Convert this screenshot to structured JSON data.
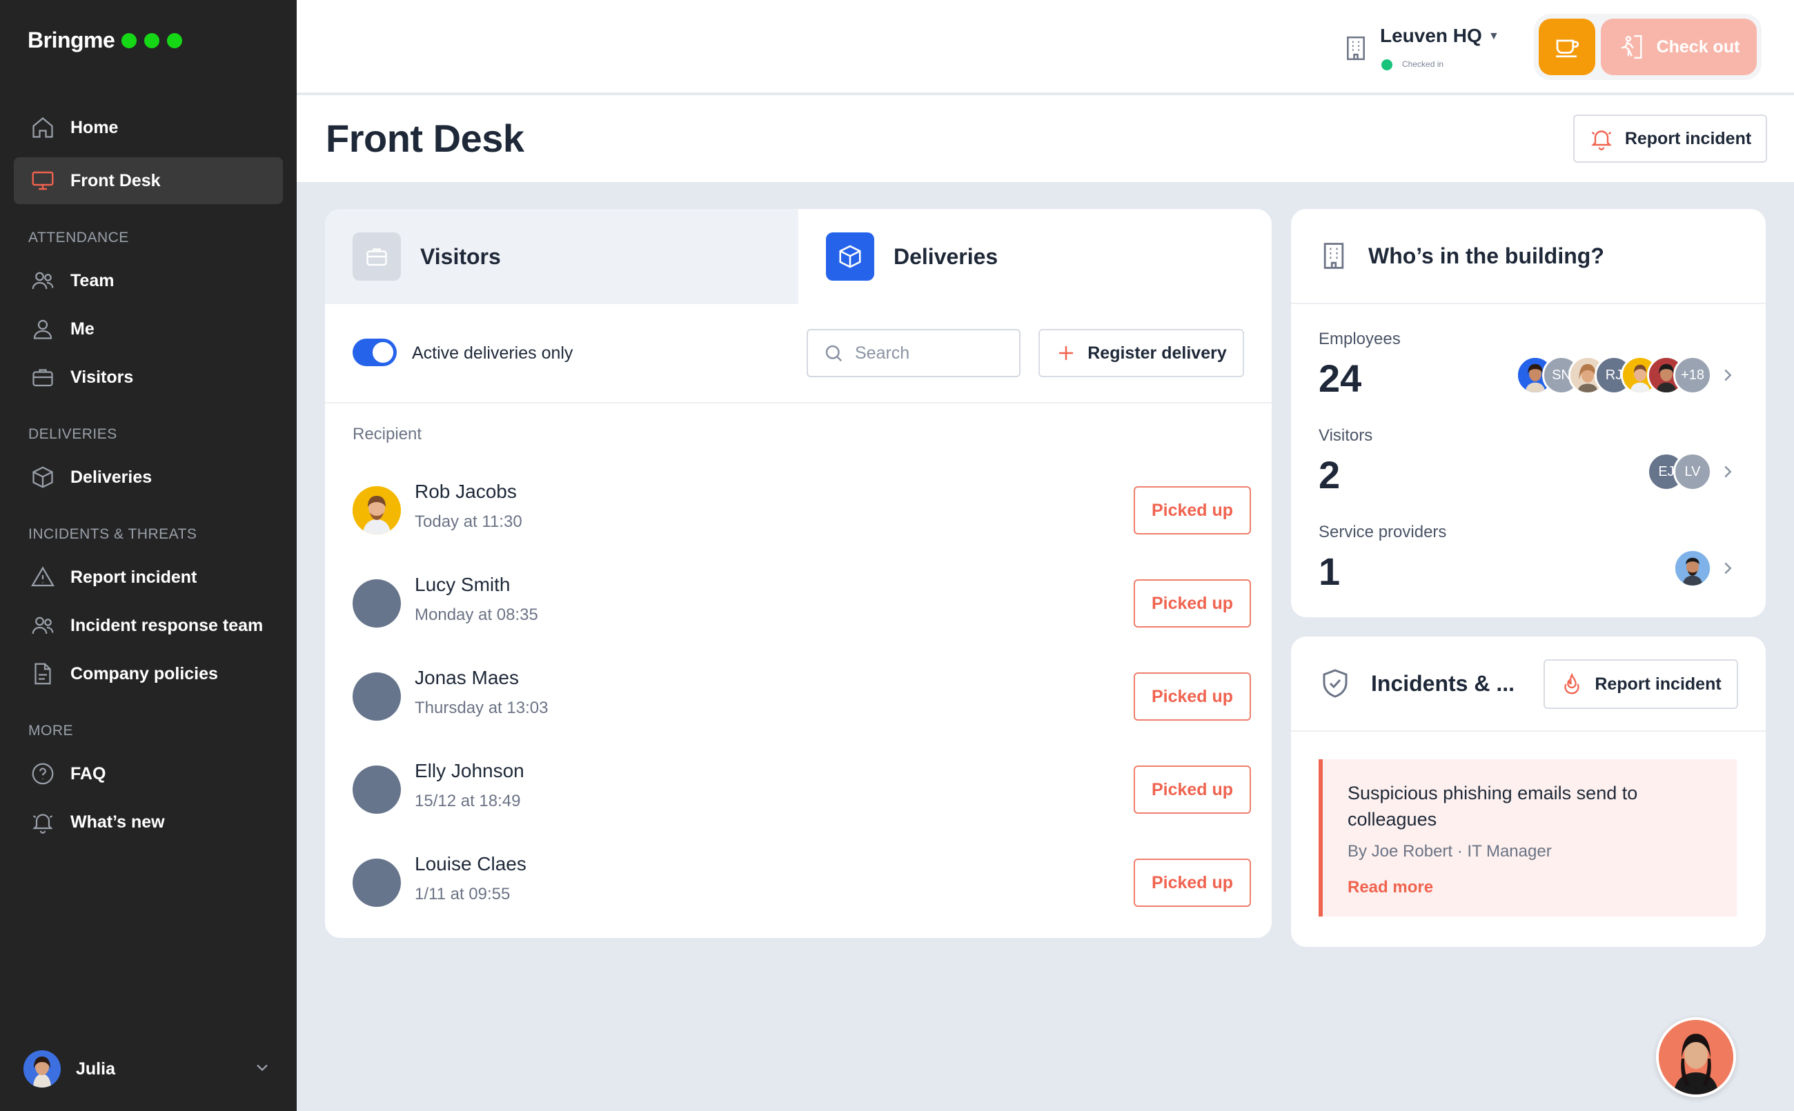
{
  "brand": {
    "name": "Bringme",
    "dot_color": "#16d716"
  },
  "sidebar": {
    "main_items": [
      {
        "label": "Home",
        "icon": "home-icon"
      },
      {
        "label": "Front Desk",
        "icon": "monitor-icon",
        "active": true
      }
    ],
    "sections": [
      {
        "title": "ATTENDANCE",
        "items": [
          {
            "label": "Team",
            "icon": "team-icon"
          },
          {
            "label": "Me",
            "icon": "user-icon"
          },
          {
            "label": "Visitors",
            "icon": "briefcase-icon"
          }
        ]
      },
      {
        "title": "DELIVERIES",
        "items": [
          {
            "label": "Deliveries",
            "icon": "box-icon"
          }
        ]
      },
      {
        "title": "INCIDENTS & THREATS",
        "items": [
          {
            "label": "Report incident",
            "icon": "warning-icon"
          },
          {
            "label": "Incident response team",
            "icon": "team-icon"
          },
          {
            "label": "Company policies",
            "icon": "document-icon"
          }
        ]
      },
      {
        "title": "MORE",
        "items": [
          {
            "label": "FAQ",
            "icon": "help-icon"
          },
          {
            "label": "What’s new",
            "icon": "bell-icon"
          }
        ]
      }
    ],
    "user": {
      "name": "Julia"
    }
  },
  "topbar": {
    "location": "Leuven HQ",
    "status": "Checked in",
    "status_color": "#17c37b",
    "checkout_label": "Check out",
    "coffee_color": "#f59b0a"
  },
  "page": {
    "title": "Front Desk",
    "report_incident_label": "Report incident"
  },
  "deliveries_card": {
    "tabs": [
      {
        "label": "Visitors"
      },
      {
        "label": "Deliveries",
        "active": true
      }
    ],
    "toggle_label": "Active deliveries only",
    "toggle_on": true,
    "search_placeholder": "Search",
    "register_label": "Register delivery",
    "column_header": "Recipient",
    "rows": [
      {
        "name": "Rob Jacobs",
        "time": "Today at 11:30",
        "action": "Picked up"
      },
      {
        "name": "Lucy Smith",
        "time": "Monday at 08:35",
        "action": "Picked up"
      },
      {
        "name": "Jonas Maes",
        "time": "Thursday at 13:03",
        "action": "Picked up"
      },
      {
        "name": "Elly Johnson",
        "time": "15/12 at 18:49",
        "action": "Picked up"
      },
      {
        "name": "Louise Claes",
        "time": "1/11 at 09:55",
        "action": "Picked up"
      }
    ]
  },
  "building_card": {
    "title": "Who’s in the building?",
    "stats": [
      {
        "label": "Employees",
        "value": "24",
        "avatars": [
          "photo",
          "SN",
          "photo",
          "RJ",
          "photo",
          "photo"
        ],
        "more": "+18"
      },
      {
        "label": "Visitors",
        "value": "2",
        "avatars": [
          "EJ",
          "LV"
        ]
      },
      {
        "label": "Service providers",
        "value": "1",
        "avatars": [
          "photo"
        ]
      }
    ]
  },
  "incidents_card": {
    "title": "Incidents & ...",
    "report_label": "Report incident",
    "incident": {
      "title": "Suspicious phishing emails send to colleagues",
      "by": "By Joe Robert · IT Manager",
      "link": "Read more"
    }
  },
  "colors": {
    "accent": "#2663eb",
    "danger": "#f0634f",
    "sidebar_bg": "#242424"
  }
}
